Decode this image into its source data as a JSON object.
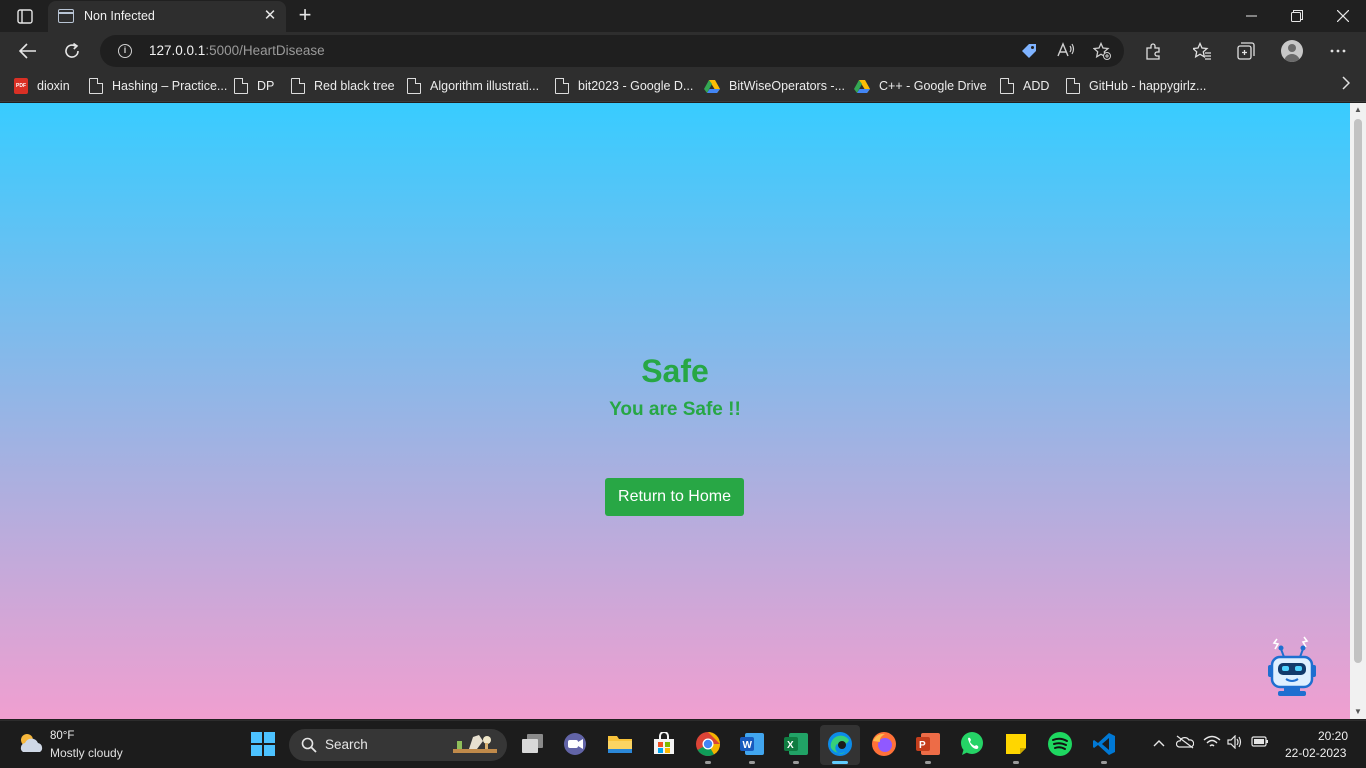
{
  "browser": {
    "tab_title": "Non Infected",
    "url_host": "127.0.0.1",
    "url_path": ":5000/HeartDisease"
  },
  "bookmarks": [
    {
      "label": "dioxin",
      "icon": "pdf-icon"
    },
    {
      "label": "Hashing – Practice...",
      "icon": "page-icon"
    },
    {
      "label": "DP",
      "icon": "page-icon"
    },
    {
      "label": "Red black tree",
      "icon": "page-icon"
    },
    {
      "label": "Algorithm illustrati...",
      "icon": "page-icon"
    },
    {
      "label": "bit2023 - Google D...",
      "icon": "page-icon"
    },
    {
      "label": "BitWiseOperators -...",
      "icon": "google-drive-icon"
    },
    {
      "label": "C++ - Google Drive",
      "icon": "google-drive-icon"
    },
    {
      "label": "ADD",
      "icon": "page-icon"
    },
    {
      "label": "GitHub - happygirlz...",
      "icon": "page-icon"
    }
  ],
  "page": {
    "title": "Safe",
    "subtitle": "You are Safe !!",
    "button_label": "Return to Home"
  },
  "colors": {
    "gradient_top": "#38ccff",
    "gradient_bottom": "#f09fd0",
    "success_text": "#27a745",
    "button_bg": "#28a745"
  },
  "taskbar": {
    "weather_temp": "80°F",
    "weather_desc": "Mostly cloudy",
    "search_label": "Search",
    "time": "20:20",
    "date": "22-02-2023",
    "apps": [
      "start-icon",
      "task-view-icon",
      "teams-icon",
      "file-explorer-icon",
      "store-icon",
      "chrome-icon",
      "word-icon",
      "excel-icon",
      "edge-icon",
      "firefox-icon",
      "powerpoint-icon",
      "whatsapp-icon",
      "sticky-notes-icon",
      "spotify-icon",
      "vscode-icon"
    ]
  }
}
